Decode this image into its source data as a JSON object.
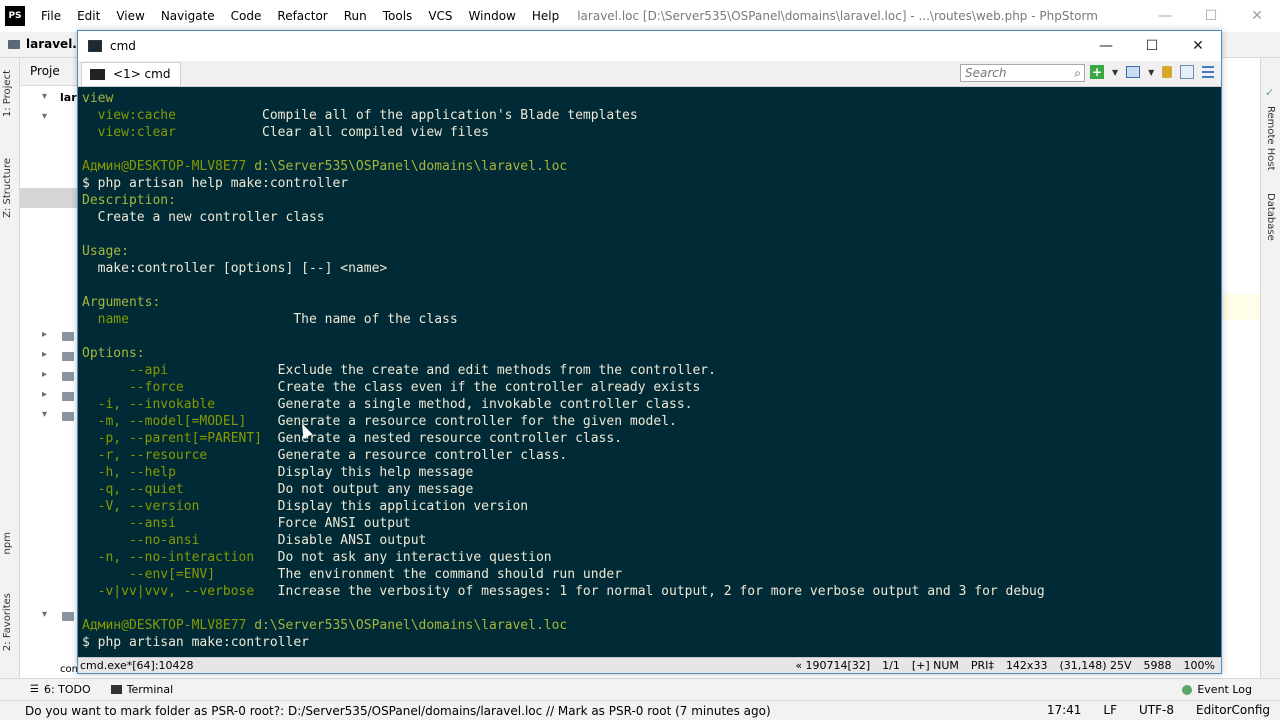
{
  "phpstorm": {
    "logo": "PS",
    "menu": [
      "File",
      "Edit",
      "View",
      "Navigate",
      "Code",
      "Refactor",
      "Run",
      "Tools",
      "VCS",
      "Window",
      "Help"
    ],
    "title": "laravel.loc [D:\\Server535\\OSPanel\\domains\\laravel.loc] - ...\\routes\\web.php - PhpStorm",
    "project_name": "laravel.lo",
    "project_tab": "Proje",
    "tree_root": "lara",
    "left_tabs": [
      "1: Project",
      "Z: Structure",
      "npm",
      "2: Favorites"
    ],
    "right_tabs": [
      "Remote Host",
      "Database"
    ],
    "tree_hint": "console.php",
    "bottom_tools": [
      {
        "key": "6",
        "label": "6: TODO"
      },
      {
        "key": "terminal",
        "label": "Terminal"
      }
    ],
    "event_log": "Event Log",
    "status_message": "Do you want to mark folder as PSR-0 root?: D:/Server535/OSPanel/domains/laravel.loc // Mark as PSR-0 root (7 minutes ago)",
    "status_right": [
      "17:41",
      "LF",
      "UTF-8",
      "EditorConfig"
    ]
  },
  "cmd": {
    "window_title": "cmd",
    "tab_label": "<1> cmd",
    "search_placeholder": "Search",
    "status_left": "cmd.exe*[64]:10428",
    "status_right": [
      "« 190714[32]",
      "1/1",
      "[+] NUM",
      "PRI‡",
      "142x33",
      "(31,148) 25V",
      "5988",
      "100%"
    ],
    "lines": [
      [
        {
          "t": "view",
          "c": "c-y"
        }
      ],
      [
        {
          "t": "  view:cache",
          "c": "c-g"
        },
        {
          "t": "           Compile all of the application's Blade templates",
          "c": "c-w"
        }
      ],
      [
        {
          "t": "  view:clear",
          "c": "c-g"
        },
        {
          "t": "           Clear all compiled view files",
          "c": "c-w"
        }
      ],
      [],
      [
        {
          "t": "Админ@DESKTOP-MLV8E77 ",
          "c": "c-g"
        },
        {
          "t": "d:\\Server535\\OSPanel\\domains\\laravel.loc",
          "c": "c-y"
        }
      ],
      [
        {
          "t": "$ php artisan help make:controller",
          "c": "c-w"
        }
      ],
      [
        {
          "t": "Description:",
          "c": "c-y"
        }
      ],
      [
        {
          "t": "  Create a new controller class",
          "c": "c-w"
        }
      ],
      [],
      [
        {
          "t": "Usage:",
          "c": "c-y"
        }
      ],
      [
        {
          "t": "  make:controller [options] [--] <name>",
          "c": "c-w"
        }
      ],
      [],
      [
        {
          "t": "Arguments:",
          "c": "c-y"
        }
      ],
      [
        {
          "t": "  name",
          "c": "c-g"
        },
        {
          "t": "                     The name of the class",
          "c": "c-w"
        }
      ],
      [],
      [
        {
          "t": "Options:",
          "c": "c-y"
        }
      ],
      [
        {
          "t": "      --api",
          "c": "c-g"
        },
        {
          "t": "              Exclude the create and edit methods from the controller.",
          "c": "c-w"
        }
      ],
      [
        {
          "t": "      --force",
          "c": "c-g"
        },
        {
          "t": "            Create the class even if the controller already exists",
          "c": "c-w"
        }
      ],
      [
        {
          "t": "  -i, --invokable",
          "c": "c-g"
        },
        {
          "t": "        Generate a single method, invokable controller class.",
          "c": "c-w"
        }
      ],
      [
        {
          "t": "  -m, --model[=MODEL]",
          "c": "c-g"
        },
        {
          "t": "    Generate a resource controller for the given model.",
          "c": "c-w"
        }
      ],
      [
        {
          "t": "  -p, --parent[=PARENT]",
          "c": "c-g"
        },
        {
          "t": "  Generate a nested resource controller class.",
          "c": "c-w"
        }
      ],
      [
        {
          "t": "  -r, --resource",
          "c": "c-g"
        },
        {
          "t": "         Generate a resource controller class.",
          "c": "c-w"
        }
      ],
      [
        {
          "t": "  -h, --help",
          "c": "c-g"
        },
        {
          "t": "             Display this help message",
          "c": "c-w"
        }
      ],
      [
        {
          "t": "  -q, --quiet",
          "c": "c-g"
        },
        {
          "t": "            Do not output any message",
          "c": "c-w"
        }
      ],
      [
        {
          "t": "  -V, --version",
          "c": "c-g"
        },
        {
          "t": "          Display this application version",
          "c": "c-w"
        }
      ],
      [
        {
          "t": "      --ansi",
          "c": "c-g"
        },
        {
          "t": "             Force ANSI output",
          "c": "c-w"
        }
      ],
      [
        {
          "t": "      --no-ansi",
          "c": "c-g"
        },
        {
          "t": "          Disable ANSI output",
          "c": "c-w"
        }
      ],
      [
        {
          "t": "  -n, --no-interaction",
          "c": "c-g"
        },
        {
          "t": "   Do not ask any interactive question",
          "c": "c-w"
        }
      ],
      [
        {
          "t": "      --env[=ENV]",
          "c": "c-g"
        },
        {
          "t": "        The environment the command should run under",
          "c": "c-w"
        }
      ],
      [
        {
          "t": "  -v|vv|vvv, --verbose",
          "c": "c-g"
        },
        {
          "t": "   Increase the verbosity of messages: 1 for normal output, 2 for more verbose output and 3 for debug",
          "c": "c-w"
        }
      ],
      [],
      [
        {
          "t": "Админ@DESKTOP-MLV8E77 ",
          "c": "c-g"
        },
        {
          "t": "d:\\Server535\\OSPanel\\domains\\laravel.loc",
          "c": "c-y"
        }
      ],
      [
        {
          "t": "$ php artisan make:controller",
          "c": "c-w"
        }
      ]
    ]
  }
}
